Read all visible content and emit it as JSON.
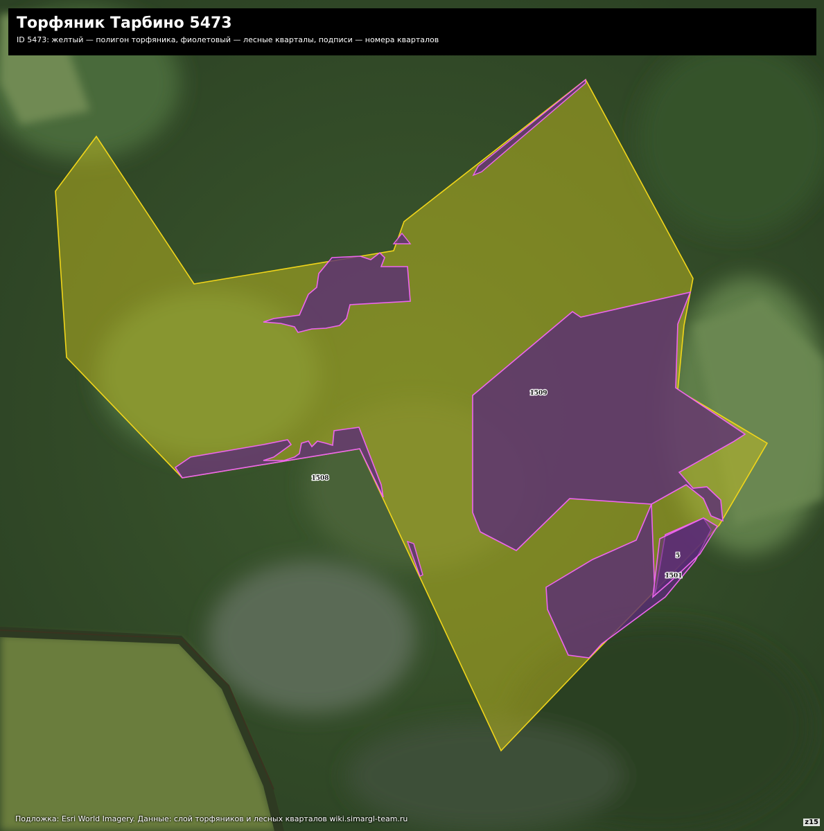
{
  "header": {
    "title": "Торфяник Тарбино 5473",
    "subtitle": "ID 5473: желтый — полигон торфяника, фиолетовый — лесные кварталы, подписи — номера кварталов"
  },
  "footer": {
    "attribution": "Подложка: Esri World Imagery. Данные: слой торфяников и лесных кварталов wiki.simargl-team.ru",
    "zoom": "z15"
  },
  "colors": {
    "peat_fill": "#c8c020",
    "peat_stroke": "#f2d61a",
    "quarter_fill": "#5a2a78",
    "quarter_stroke": "#ee66ee"
  },
  "quarter_labels": {
    "q1509": "1509",
    "q1508": "1508",
    "q5": "5",
    "q1501": "1501"
  }
}
